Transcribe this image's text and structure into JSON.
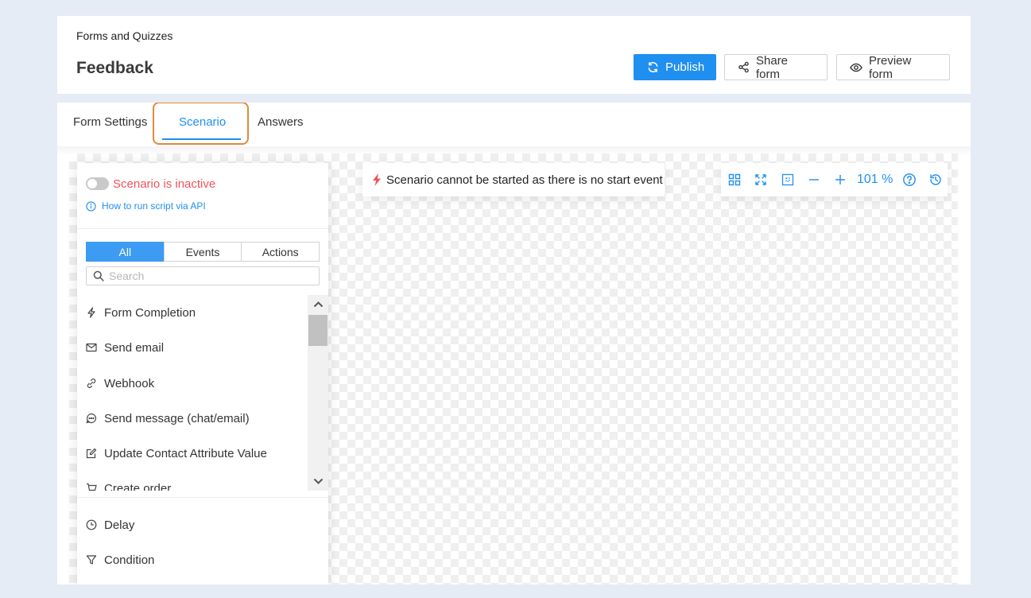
{
  "header": {
    "breadcrumb": "Forms and Quizzes",
    "title": "Feedback",
    "publish_label": "Publish",
    "share_label": "Share form",
    "preview_label": "Preview form"
  },
  "tabs": [
    {
      "label": "Form Settings",
      "active": false
    },
    {
      "label": "Scenario",
      "active": true
    },
    {
      "label": "Answers",
      "active": false
    }
  ],
  "panel": {
    "status_text": "Scenario is inactive",
    "toggle_on": false,
    "api_link": "How to run script via API",
    "filters": [
      "All",
      "Events",
      "Actions"
    ],
    "active_filter": "All",
    "search_placeholder": "Search",
    "items": [
      {
        "label": "Form Completion",
        "icon": "lightning-icon"
      },
      {
        "label": "Send email",
        "icon": "envelope-icon"
      },
      {
        "label": "Webhook",
        "icon": "webhook-icon"
      },
      {
        "label": "Send message (chat/email)",
        "icon": "chat-bubble-icon"
      },
      {
        "label": "Update Contact Attribute Value",
        "icon": "edit-icon"
      },
      {
        "label": "Create order",
        "icon": "cart-icon"
      }
    ],
    "fixed_items": [
      {
        "label": "Delay",
        "icon": "clock-icon"
      },
      {
        "label": "Condition",
        "icon": "filter-icon"
      }
    ]
  },
  "canvas": {
    "warning": "Scenario cannot be started as there is no start event",
    "zoom": "101 %"
  },
  "colors": {
    "accent": "#1f8ff0",
    "danger": "#f0545a",
    "tab_highlight": "#e08a3a"
  }
}
